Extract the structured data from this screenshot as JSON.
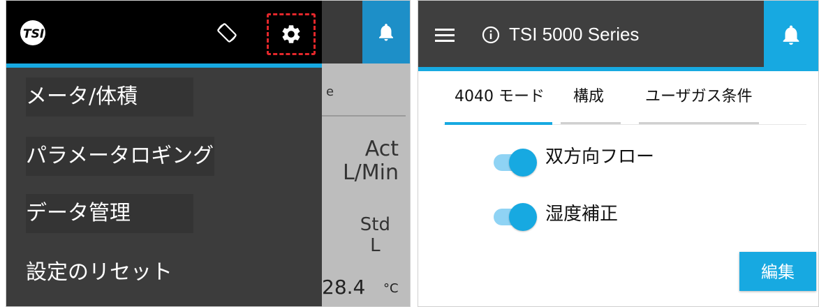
{
  "colors": {
    "accent": "#17a9e1",
    "highlight_border": "#e3272b",
    "drawer_bg": "#3c3c3c",
    "toolbar_bg": "#000000"
  },
  "left": {
    "logo_text": "TSI",
    "icons": [
      "screen-rotation-icon",
      "gear-icon",
      "bell-icon"
    ],
    "menu": [
      {
        "label": "メータ/体積"
      },
      {
        "label": "パラメータロギング"
      },
      {
        "label": "データ管理"
      },
      {
        "label": "設定のリセット"
      }
    ],
    "background": {
      "tab_fragment": "e",
      "unit_act_1": "Act",
      "unit_act_2": "L/Min",
      "unit_std_1": "Std",
      "unit_std_2": "L",
      "temp_value": "28.4",
      "temp_unit": "°C"
    }
  },
  "right": {
    "title": "TSI 5000 Series",
    "icons": [
      "menu-icon",
      "info-icon",
      "bell-icon"
    ],
    "tabs": [
      {
        "label": "4040 モード",
        "active": true
      },
      {
        "label": "構成",
        "active": false
      },
      {
        "label": "ユーザガス条件",
        "active": false
      }
    ],
    "toggles": [
      {
        "label": "双方向フロー",
        "on": true
      },
      {
        "label": "湿度補正",
        "on": true
      }
    ],
    "edit_label": "編集"
  }
}
